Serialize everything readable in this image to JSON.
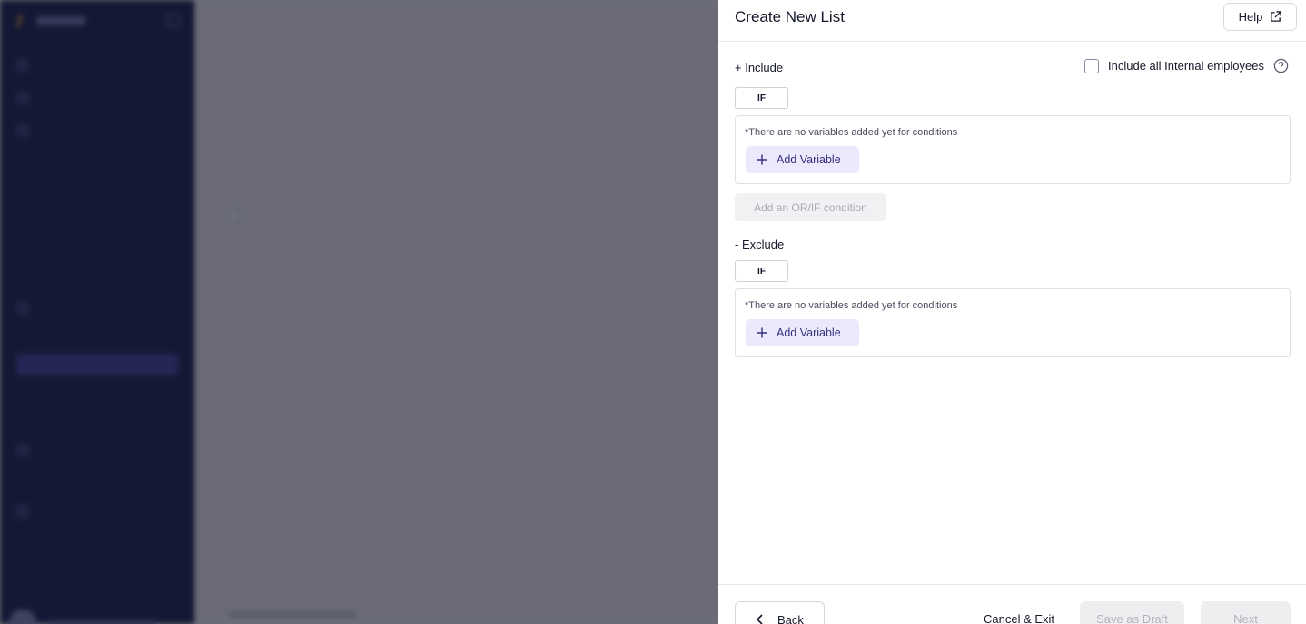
{
  "drawer": {
    "title": "Create New List",
    "help_label": "Help",
    "include": {
      "label": "+ Include",
      "if_label": "IF",
      "empty_text": "*There are no variables added yet for conditions",
      "add_variable_label": "Add Variable",
      "or_if_label": "Add an OR/IF condition"
    },
    "internal_employees": {
      "label": "Include all Internal employees",
      "checked": false
    },
    "exclude": {
      "label": "- Exclude",
      "if_label": "IF",
      "empty_text": "*There are no variables added yet for conditions",
      "add_variable_label": "Add Variable"
    },
    "footer": {
      "back_label": "Back",
      "cancel_label": "Cancel & Exit",
      "draft_label": "Save as Draft",
      "next_label": "Next"
    }
  },
  "colors": {
    "sidebar_bg": "#141a4a",
    "accent": "#3b3f9e",
    "add_variable_bg": "#ebe9fb",
    "add_variable_text": "#34317f",
    "disabled_bg": "#eeeef1",
    "disabled_text": "#b1b2be"
  }
}
